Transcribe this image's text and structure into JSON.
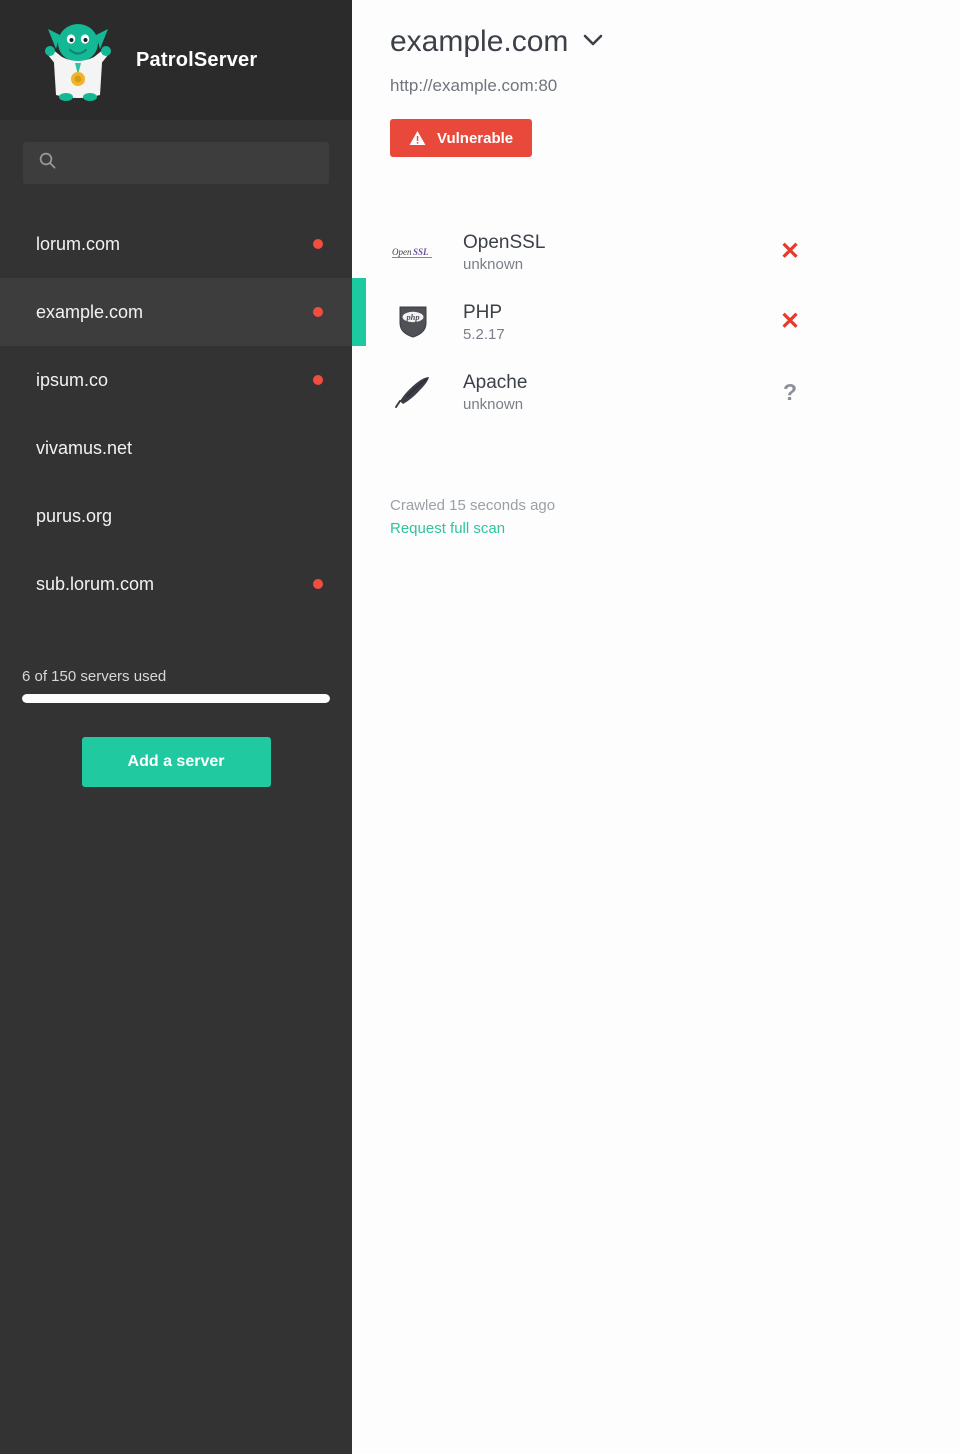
{
  "brand": {
    "title": "PatrolServer",
    "logo_icon": "goblin-mascot-logo"
  },
  "sidebar": {
    "search": {
      "placeholder": "",
      "value": "",
      "icon": "search-icon"
    },
    "servers": [
      {
        "name": "lorum.com",
        "alert": true,
        "selected": false
      },
      {
        "name": "example.com",
        "alert": true,
        "selected": true
      },
      {
        "name": "ipsum.co",
        "alert": true,
        "selected": false
      },
      {
        "name": "vivamus.net",
        "alert": false,
        "selected": false
      },
      {
        "name": "purus.org",
        "alert": false,
        "selected": false
      },
      {
        "name": "sub.lorum.com",
        "alert": true,
        "selected": false
      }
    ],
    "usage": {
      "label": "6 of 150 servers used",
      "used": 6,
      "total": 150,
      "fill_percent": 100
    },
    "add_server_label": "Add a server"
  },
  "main": {
    "title": "example.com",
    "title_chevron_icon": "chevron-down-icon",
    "url": "http://example.com:80",
    "status_badge": {
      "label": "Vulnerable",
      "icon": "warning-triangle-icon",
      "color": "#e8493a"
    },
    "software": [
      {
        "icon": "openssl-logo-icon",
        "name": "OpenSSL",
        "version": "unknown",
        "status": "✕",
        "status_kind": "bad"
      },
      {
        "icon": "php-shield-icon",
        "name": "PHP",
        "version": "5.2.17",
        "status": "✕",
        "status_kind": "bad"
      },
      {
        "icon": "apache-feather-icon",
        "name": "Apache",
        "version": "unknown",
        "status": "?",
        "status_kind": "unknown"
      }
    ],
    "crawled_text": "Crawled 15 seconds ago",
    "scan_link_label": "Request full scan"
  },
  "colors": {
    "accent_teal": "#20c9a0",
    "alert_red": "#f04e3e",
    "badge_red": "#e8493a",
    "sidebar_bg": "#333333",
    "sidebar_header_bg": "#2b2b2b"
  }
}
